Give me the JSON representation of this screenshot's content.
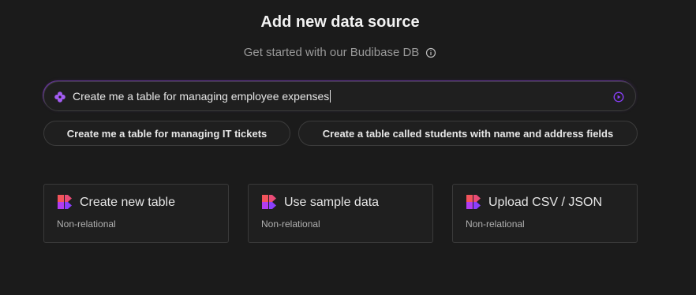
{
  "header": {
    "title": "Add new data source",
    "subtitle": "Get started with our Budibase DB"
  },
  "prompt": {
    "value": "Create me a table for managing employee expenses"
  },
  "suggestions": [
    {
      "label": "Create me a table for managing IT tickets"
    },
    {
      "label": "Create a table called students with name and address fields"
    }
  ],
  "cards": [
    {
      "title": "Create new table",
      "subtitle": "Non-relational"
    },
    {
      "title": "Use sample data",
      "subtitle": "Non-relational"
    },
    {
      "title": "Upload CSV / JSON",
      "subtitle": "Non-relational"
    }
  ],
  "colors": {
    "background": "#1b1b1b",
    "accent_purple": "#9546e9",
    "logo_red": "#f2545b",
    "logo_purple": "#8a3ffc"
  },
  "icons": [
    "info-icon",
    "ai-sparkle-icon",
    "send-icon",
    "budibase-logo-icon"
  ]
}
